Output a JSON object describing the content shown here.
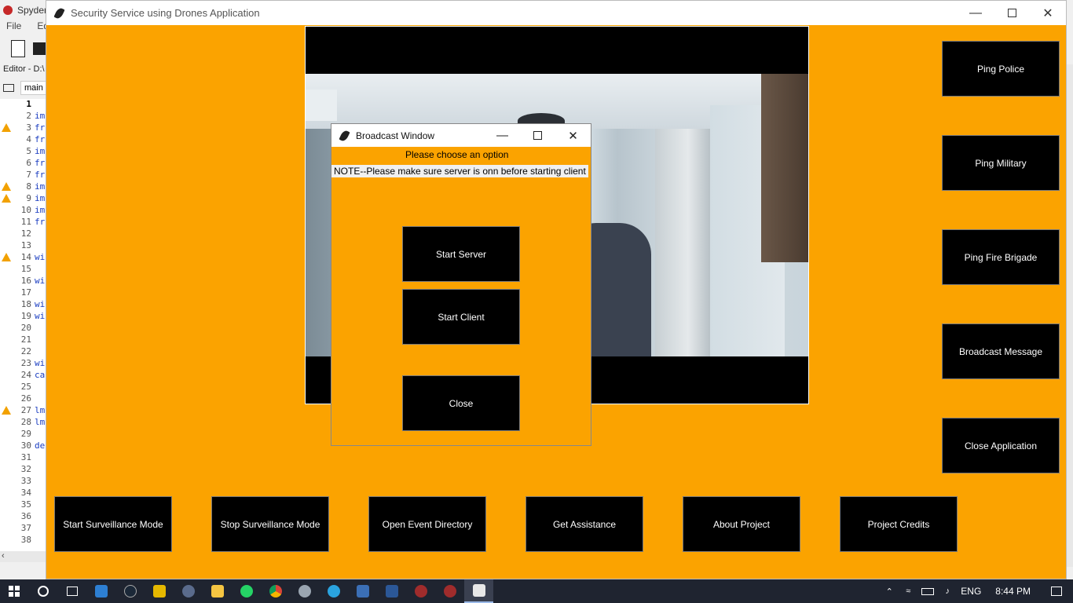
{
  "spyder": {
    "title": "Spyder",
    "menu": [
      "File",
      "Edi"
    ],
    "editor_label": "Editor - D:\\",
    "tab_label": "main",
    "lines": [
      {
        "n": "1",
        "code": "",
        "warn": false
      },
      {
        "n": "2",
        "code": "im",
        "warn": false
      },
      {
        "n": "3",
        "code": "fr",
        "warn": true
      },
      {
        "n": "4",
        "code": "fr",
        "warn": false
      },
      {
        "n": "5",
        "code": "im",
        "warn": false
      },
      {
        "n": "6",
        "code": "fr",
        "warn": false
      },
      {
        "n": "7",
        "code": "fr",
        "warn": false
      },
      {
        "n": "8",
        "code": "im",
        "warn": true
      },
      {
        "n": "9",
        "code": "im",
        "warn": true
      },
      {
        "n": "10",
        "code": "im",
        "warn": false
      },
      {
        "n": "11",
        "code": "fr",
        "warn": false
      },
      {
        "n": "12",
        "code": "",
        "warn": false
      },
      {
        "n": "13",
        "code": "",
        "warn": false
      },
      {
        "n": "14",
        "code": "wi",
        "warn": true
      },
      {
        "n": "15",
        "code": "",
        "warn": false
      },
      {
        "n": "16",
        "code": "wi",
        "warn": false
      },
      {
        "n": "17",
        "code": "",
        "warn": false
      },
      {
        "n": "18",
        "code": "wi",
        "warn": false
      },
      {
        "n": "19",
        "code": "wi",
        "warn": false
      },
      {
        "n": "20",
        "code": "",
        "warn": false
      },
      {
        "n": "21",
        "code": "",
        "warn": false
      },
      {
        "n": "22",
        "code": "",
        "warn": false
      },
      {
        "n": "23",
        "code": "wi",
        "warn": false
      },
      {
        "n": "24",
        "code": "ca",
        "warn": false
      },
      {
        "n": "25",
        "code": "",
        "warn": false
      },
      {
        "n": "26",
        "code": "",
        "warn": false
      },
      {
        "n": "27",
        "code": "lm",
        "warn": true
      },
      {
        "n": "28",
        "code": "lm",
        "warn": false
      },
      {
        "n": "29",
        "code": "",
        "warn": false
      },
      {
        "n": "30",
        "code": "de",
        "warn": false
      },
      {
        "n": "31",
        "code": "",
        "warn": false
      },
      {
        "n": "32",
        "code": "",
        "warn": false
      },
      {
        "n": "33",
        "code": "",
        "warn": false
      },
      {
        "n": "34",
        "code": "",
        "warn": false
      },
      {
        "n": "35",
        "code": "",
        "warn": false
      },
      {
        "n": "36",
        "code": "",
        "warn": false
      },
      {
        "n": "37",
        "code": "",
        "warn": false
      },
      {
        "n": "38",
        "code": "",
        "warn": false
      }
    ]
  },
  "app": {
    "title": "Security Service using Drones Application",
    "side_buttons": {
      "ping_police": "Ping Police",
      "ping_military": "Ping Military",
      "ping_fire": "Ping Fire Brigade",
      "broadcast": "Broadcast Message",
      "close_app": "Close Application"
    },
    "bottom_buttons": {
      "start_surveillance": "Start Surveillance Mode",
      "stop_surveillance": "Stop Surveillance Mode",
      "open_events": "Open Event Directory",
      "get_assistance": "Get Assistance",
      "about": "About Project",
      "credits": "Project Credits"
    },
    "accent_color": "#fba300"
  },
  "dialog": {
    "title": "Broadcast Window",
    "prompt": "Please choose an option",
    "note": "NOTE--Please make sure server is onn before starting client",
    "start_server": "Start Server",
    "start_client": "Start Client",
    "close": "Close"
  },
  "taskbar": {
    "language": "ENG",
    "time": "8:44 PM",
    "apps": [
      "file-explorer-icon",
      "steam-icon",
      "app-icon",
      "files-icon",
      "folder-icon",
      "whatsapp-icon",
      "chrome-icon",
      "app-icon-2",
      "telegram-icon",
      "app-icon-3",
      "word-icon",
      "spyder-icon",
      "spyder-icon-2",
      "notepad-icon"
    ]
  }
}
